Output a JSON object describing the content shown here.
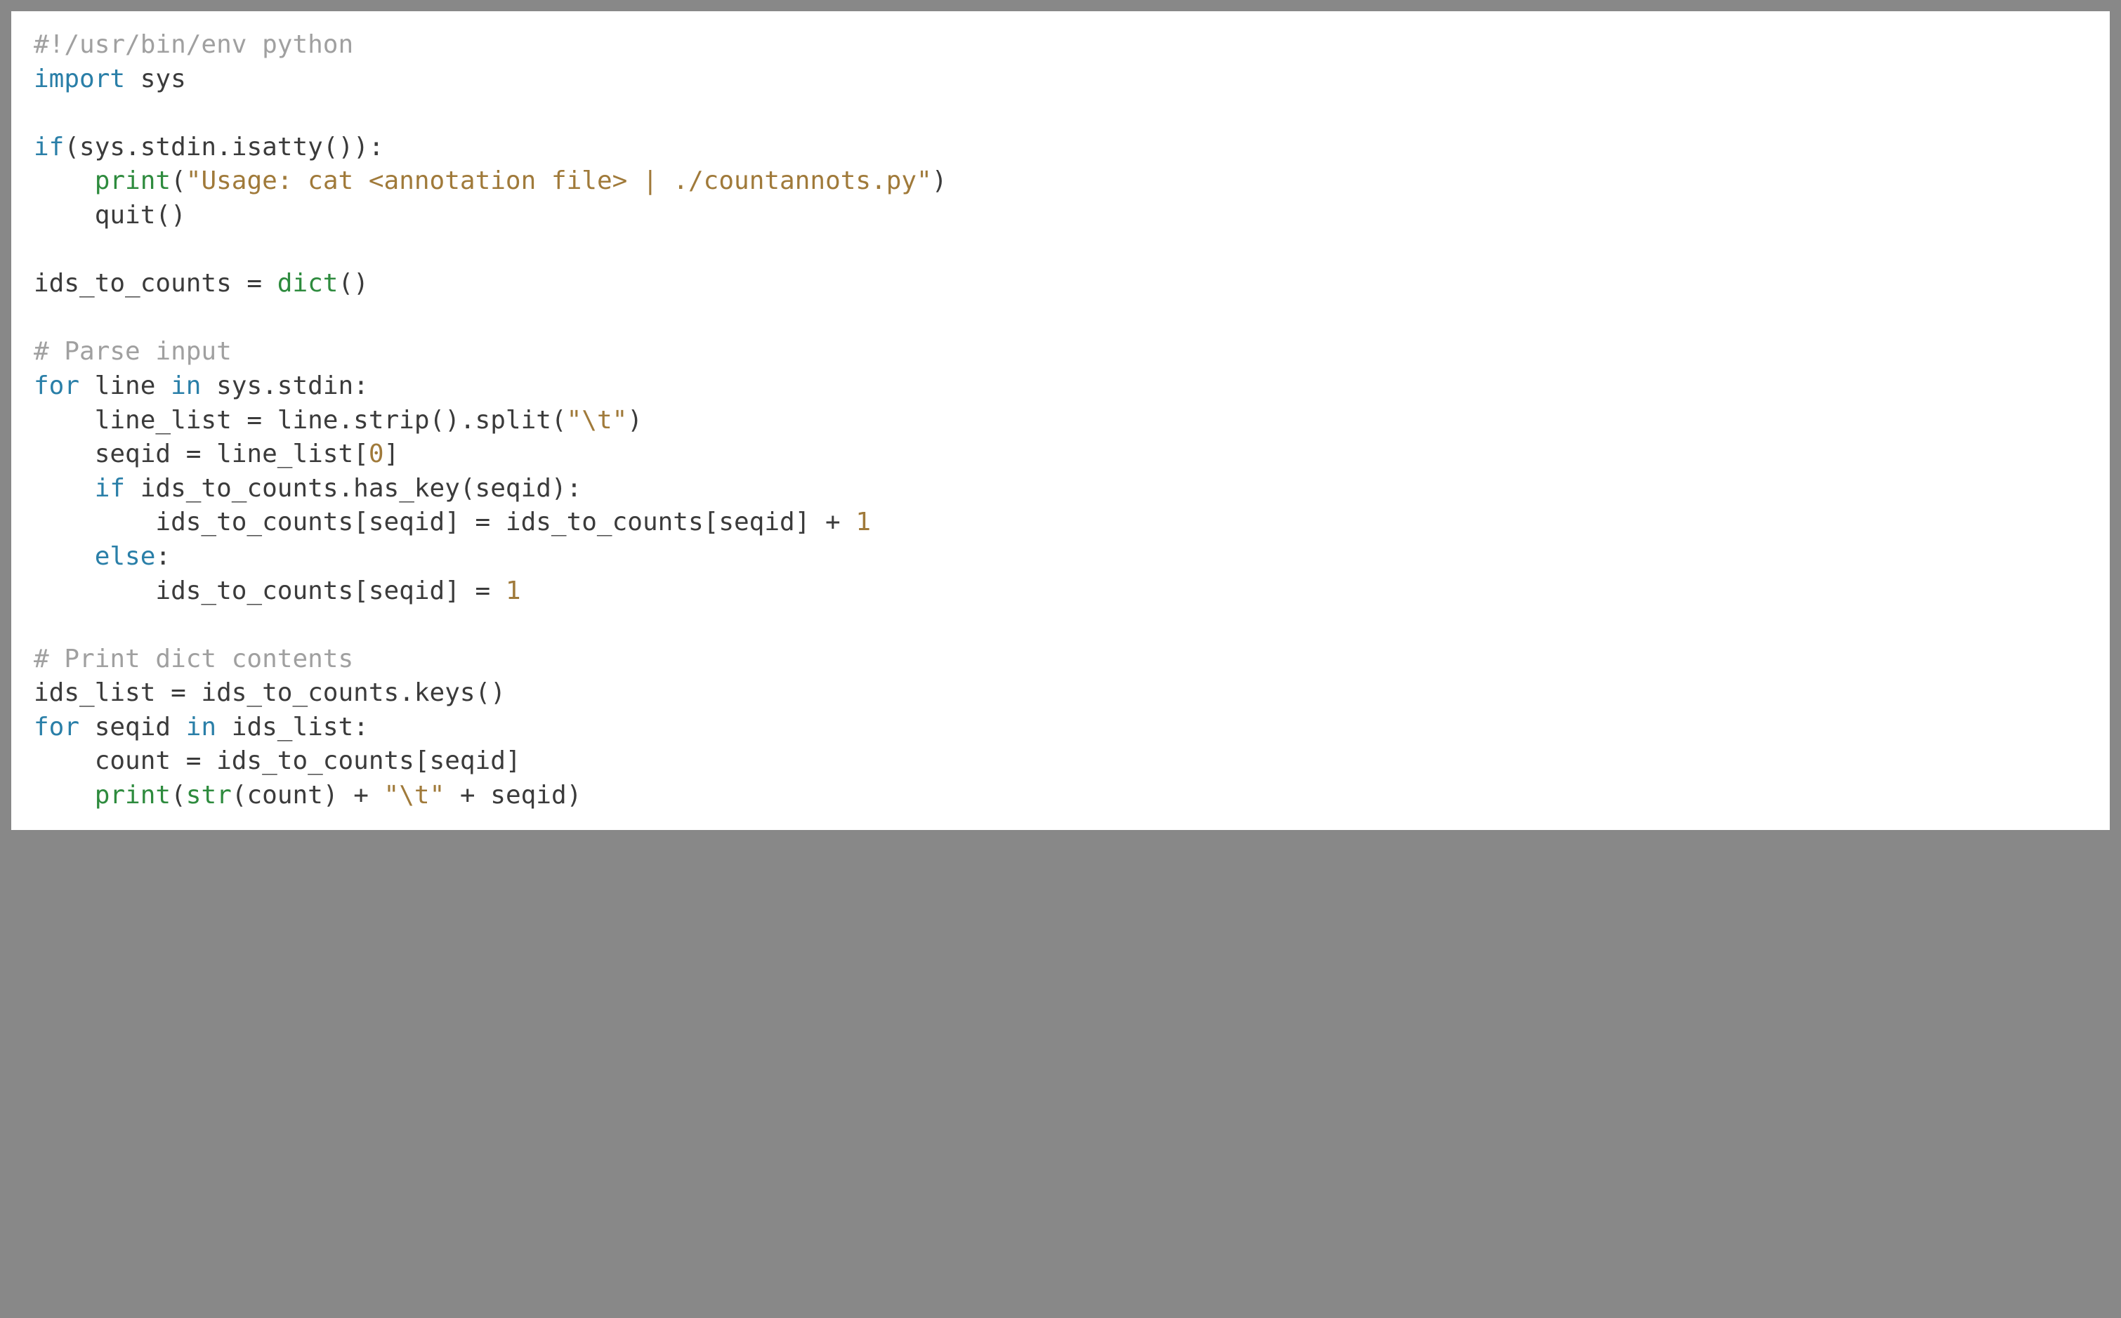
{
  "code": {
    "lines": [
      [
        {
          "cls": "tok-comment",
          "text": "#!/usr/bin/env python"
        }
      ],
      [
        {
          "cls": "tok-keyword",
          "text": "import"
        },
        {
          "cls": "tok-default",
          "text": " sys"
        }
      ],
      [
        {
          "cls": "tok-default",
          "text": ""
        }
      ],
      [
        {
          "cls": "tok-keyword",
          "text": "if"
        },
        {
          "cls": "tok-default",
          "text": "(sys.stdin.isatty()):"
        }
      ],
      [
        {
          "cls": "tok-default",
          "text": "    "
        },
        {
          "cls": "tok-builtin",
          "text": "print"
        },
        {
          "cls": "tok-default",
          "text": "("
        },
        {
          "cls": "tok-string",
          "text": "\"Usage: cat <annotation file> | ./countannots.py\""
        },
        {
          "cls": "tok-default",
          "text": ")"
        }
      ],
      [
        {
          "cls": "tok-default",
          "text": "    quit()"
        }
      ],
      [
        {
          "cls": "tok-default",
          "text": ""
        }
      ],
      [
        {
          "cls": "tok-default",
          "text": "ids_to_counts = "
        },
        {
          "cls": "tok-builtin",
          "text": "dict"
        },
        {
          "cls": "tok-default",
          "text": "()"
        }
      ],
      [
        {
          "cls": "tok-default",
          "text": ""
        }
      ],
      [
        {
          "cls": "tok-comment",
          "text": "# Parse input"
        }
      ],
      [
        {
          "cls": "tok-keyword",
          "text": "for"
        },
        {
          "cls": "tok-default",
          "text": " line "
        },
        {
          "cls": "tok-keyword",
          "text": "in"
        },
        {
          "cls": "tok-default",
          "text": " sys.stdin:"
        }
      ],
      [
        {
          "cls": "tok-default",
          "text": "    line_list = line.strip().split("
        },
        {
          "cls": "tok-string",
          "text": "\"\\t\""
        },
        {
          "cls": "tok-default",
          "text": ")"
        }
      ],
      [
        {
          "cls": "tok-default",
          "text": "    seqid = line_list["
        },
        {
          "cls": "tok-number",
          "text": "0"
        },
        {
          "cls": "tok-default",
          "text": "]"
        }
      ],
      [
        {
          "cls": "tok-default",
          "text": "    "
        },
        {
          "cls": "tok-keyword",
          "text": "if"
        },
        {
          "cls": "tok-default",
          "text": " ids_to_counts.has_key(seqid):"
        }
      ],
      [
        {
          "cls": "tok-default",
          "text": "        ids_to_counts[seqid] = ids_to_counts[seqid] + "
        },
        {
          "cls": "tok-number",
          "text": "1"
        }
      ],
      [
        {
          "cls": "tok-default",
          "text": "    "
        },
        {
          "cls": "tok-keyword",
          "text": "else"
        },
        {
          "cls": "tok-default",
          "text": ":"
        }
      ],
      [
        {
          "cls": "tok-default",
          "text": "        ids_to_counts[seqid] = "
        },
        {
          "cls": "tok-number",
          "text": "1"
        }
      ],
      [
        {
          "cls": "tok-default",
          "text": ""
        }
      ],
      [
        {
          "cls": "tok-comment",
          "text": "# Print dict contents"
        }
      ],
      [
        {
          "cls": "tok-default",
          "text": "ids_list = ids_to_counts.keys()"
        }
      ],
      [
        {
          "cls": "tok-keyword",
          "text": "for"
        },
        {
          "cls": "tok-default",
          "text": " seqid "
        },
        {
          "cls": "tok-keyword",
          "text": "in"
        },
        {
          "cls": "tok-default",
          "text": " ids_list:"
        }
      ],
      [
        {
          "cls": "tok-default",
          "text": "    count = ids_to_counts[seqid]"
        }
      ],
      [
        {
          "cls": "tok-default",
          "text": "    "
        },
        {
          "cls": "tok-builtin",
          "text": "print"
        },
        {
          "cls": "tok-default",
          "text": "("
        },
        {
          "cls": "tok-builtin",
          "text": "str"
        },
        {
          "cls": "tok-default",
          "text": "(count) + "
        },
        {
          "cls": "tok-string",
          "text": "\"\\t\""
        },
        {
          "cls": "tok-default",
          "text": " + seqid)"
        }
      ]
    ]
  }
}
